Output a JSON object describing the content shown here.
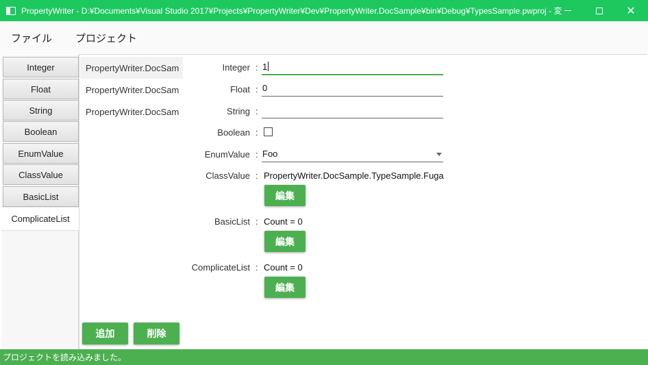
{
  "window": {
    "title": "PropertyWriter - D:¥Documents¥Visual Studio 2017¥Projects¥PropertyWriter¥Dev¥PropertyWriter.DocSample¥bin¥Debug¥TypesSample.pwproj - 変…",
    "minimize_glyph": "",
    "maximize_glyph": "",
    "close_glyph": "✕",
    "accent": "#1dc85f"
  },
  "menu": {
    "items": [
      {
        "label": "ファイル"
      },
      {
        "label": "プロジェクト"
      }
    ]
  },
  "tabs": {
    "items": [
      {
        "label": "Integer"
      },
      {
        "label": "Float"
      },
      {
        "label": "String"
      },
      {
        "label": "Boolean"
      },
      {
        "label": "EnumValue"
      },
      {
        "label": "ClassValue"
      },
      {
        "label": "BasicList"
      },
      {
        "label": "ComplicateList"
      }
    ],
    "active": "ComplicateList"
  },
  "list": {
    "items": [
      {
        "label": "PropertyWriter.DocSam"
      },
      {
        "label": "PropertyWriter.DocSam"
      },
      {
        "label": "PropertyWriter.DocSam"
      }
    ]
  },
  "properties": {
    "colon": ":",
    "integer": {
      "label": "Integer",
      "value": "1"
    },
    "float": {
      "label": "Float",
      "value": "0"
    },
    "string": {
      "label": "String",
      "value": ""
    },
    "boolean": {
      "label": "Boolean",
      "checked": false
    },
    "enum": {
      "label": "EnumValue",
      "value": "Foo"
    },
    "class": {
      "label": "ClassValue",
      "value": "PropertyWriter.DocSample.TypeSample.Fuga",
      "button": "編集"
    },
    "basic_list": {
      "label": "BasicList",
      "value": "Count = 0",
      "button": "編集"
    },
    "complicate_list": {
      "label": "ComplicateList",
      "value": "Count = 0",
      "button": "編集"
    }
  },
  "actions": {
    "add_label": "追加",
    "delete_label": "削除",
    "button_color": "#4caf50"
  },
  "status": {
    "text": "プロジェクトを読み込みました。"
  }
}
